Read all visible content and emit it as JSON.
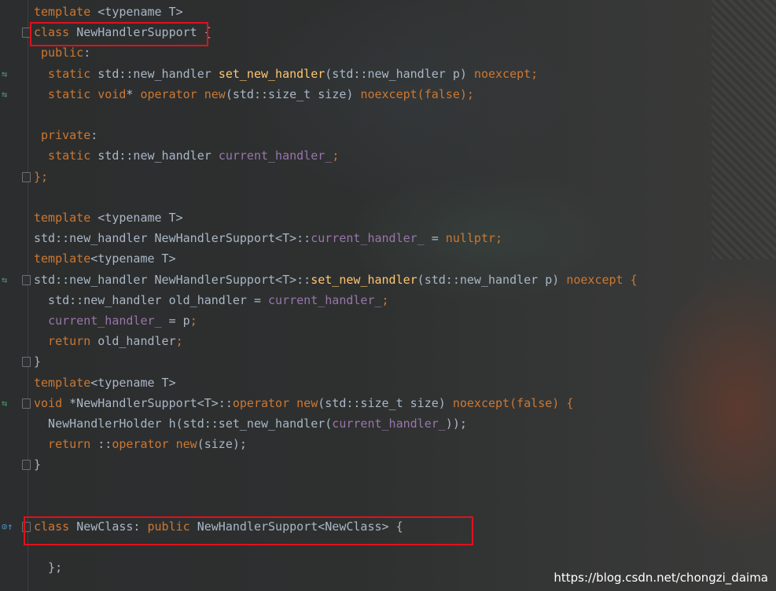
{
  "code_lines": [
    {
      "icon": "",
      "fold": false,
      "tokens": [
        {
          "t": "template ",
          "c": "kw"
        },
        {
          "t": "<typename T>",
          "c": "tk"
        }
      ]
    },
    {
      "icon": "",
      "fold": true,
      "tokens": [
        {
          "t": "class ",
          "c": "kw"
        },
        {
          "t": "NewHandlerSupport ",
          "c": "tk"
        },
        {
          "t": "{",
          "c": "tk"
        }
      ]
    },
    {
      "icon": "",
      "fold": false,
      "tokens": [
        {
          "t": " public",
          "c": "kw"
        },
        {
          "t": ":",
          "c": "tk"
        }
      ]
    },
    {
      "icon": "⇆",
      "fold": false,
      "tokens": [
        {
          "t": "  static ",
          "c": "kw"
        },
        {
          "t": "std::new_handler ",
          "c": "tk"
        },
        {
          "t": "set_new_handler",
          "c": "fn"
        },
        {
          "t": "(std::new_handler p) ",
          "c": "tk"
        },
        {
          "t": "noexcept;",
          "c": "kw"
        }
      ]
    },
    {
      "icon": "⇆",
      "fold": false,
      "tokens": [
        {
          "t": "  static void",
          "c": "kw"
        },
        {
          "t": "* ",
          "c": "tk"
        },
        {
          "t": "operator new",
          "c": "kw"
        },
        {
          "t": "(std::size_t size) ",
          "c": "tk"
        },
        {
          "t": "noexcept(false);",
          "c": "kw"
        }
      ]
    },
    {
      "icon": "",
      "fold": false,
      "tokens": []
    },
    {
      "icon": "",
      "fold": false,
      "tokens": [
        {
          "t": " private",
          "c": "kw"
        },
        {
          "t": ":",
          "c": "tk"
        }
      ]
    },
    {
      "icon": "",
      "fold": false,
      "tokens": [
        {
          "t": "  static ",
          "c": "kw"
        },
        {
          "t": "std::new_handler ",
          "c": "tk"
        },
        {
          "t": "current_handler_",
          "c": "fld"
        },
        {
          "t": ";",
          "c": "kw"
        }
      ]
    },
    {
      "icon": "",
      "fold": true,
      "tokens": [
        {
          "t": "};",
          "c": "kw"
        }
      ]
    },
    {
      "icon": "",
      "fold": false,
      "tokens": []
    },
    {
      "icon": "",
      "fold": false,
      "tokens": [
        {
          "t": "template ",
          "c": "kw"
        },
        {
          "t": "<typename T>",
          "c": "tk"
        }
      ]
    },
    {
      "icon": "",
      "fold": false,
      "tokens": [
        {
          "t": "std::new_handler NewHandlerSupport<T>::",
          "c": "tk"
        },
        {
          "t": "current_handler_",
          "c": "fld"
        },
        {
          "t": " = ",
          "c": "tk"
        },
        {
          "t": "nullptr;",
          "c": "kw"
        }
      ]
    },
    {
      "icon": "",
      "fold": false,
      "tokens": [
        {
          "t": "template",
          "c": "kw"
        },
        {
          "t": "<typename T>",
          "c": "tk"
        }
      ]
    },
    {
      "icon": "⇆",
      "fold": true,
      "tokens": [
        {
          "t": "std::new_handler NewHandlerSupport<T>::",
          "c": "tk"
        },
        {
          "t": "set_new_handler",
          "c": "fn"
        },
        {
          "t": "(std::new_handler p) ",
          "c": "tk"
        },
        {
          "t": "noexcept {",
          "c": "kw"
        }
      ]
    },
    {
      "icon": "",
      "fold": false,
      "tokens": [
        {
          "t": "  std::new_handler old_handler = ",
          "c": "tk"
        },
        {
          "t": "current_handler_",
          "c": "fld"
        },
        {
          "t": ";",
          "c": "kw"
        }
      ]
    },
    {
      "icon": "",
      "fold": false,
      "tokens": [
        {
          "t": "  ",
          "c": "tk"
        },
        {
          "t": "current_handler_",
          "c": "fld"
        },
        {
          "t": " = p",
          "c": "tk"
        },
        {
          "t": ";",
          "c": "kw"
        }
      ]
    },
    {
      "icon": "",
      "fold": false,
      "tokens": [
        {
          "t": "  return ",
          "c": "kw"
        },
        {
          "t": "old_handler",
          "c": "tk"
        },
        {
          "t": ";",
          "c": "kw"
        }
      ]
    },
    {
      "icon": "",
      "fold": true,
      "tokens": [
        {
          "t": "}",
          "c": "tk"
        }
      ]
    },
    {
      "icon": "",
      "fold": false,
      "tokens": [
        {
          "t": "template",
          "c": "kw"
        },
        {
          "t": "<typename T>",
          "c": "tk"
        }
      ]
    },
    {
      "icon": "⇆",
      "fold": true,
      "tokens": [
        {
          "t": "void ",
          "c": "kw"
        },
        {
          "t": "*NewHandlerSupport<T>::",
          "c": "tk"
        },
        {
          "t": "operator new",
          "c": "kw"
        },
        {
          "t": "(std::size_t size) ",
          "c": "tk"
        },
        {
          "t": "noexcept(false) {",
          "c": "kw"
        }
      ]
    },
    {
      "icon": "",
      "fold": false,
      "tokens": [
        {
          "t": "  NewHandlerHolder h(std::set_new_handler(",
          "c": "tk"
        },
        {
          "t": "current_handler_",
          "c": "fld"
        },
        {
          "t": "));",
          "c": "tk"
        }
      ]
    },
    {
      "icon": "",
      "fold": false,
      "tokens": [
        {
          "t": "  return ",
          "c": "kw"
        },
        {
          "t": "::",
          "c": "tk"
        },
        {
          "t": "operator new",
          "c": "kw"
        },
        {
          "t": "(size);",
          "c": "tk"
        }
      ]
    },
    {
      "icon": "",
      "fold": true,
      "tokens": [
        {
          "t": "}",
          "c": "tk"
        }
      ]
    },
    {
      "icon": "",
      "fold": false,
      "tokens": []
    },
    {
      "icon": "",
      "fold": false,
      "tokens": []
    },
    {
      "icon": "⊙↑",
      "fold": true,
      "tokens": [
        {
          "t": "class ",
          "c": "kw"
        },
        {
          "t": "NewClass: ",
          "c": "tk"
        },
        {
          "t": "public ",
          "c": "kw"
        },
        {
          "t": "NewHandlerSupport<NewClass> {",
          "c": "tk"
        }
      ]
    },
    {
      "icon": "",
      "fold": false,
      "tokens": []
    },
    {
      "icon": "",
      "fold": false,
      "tokens": [
        {
          "t": "  };",
          "c": "tk"
        }
      ]
    }
  ],
  "watermark": "https://blog.csdn.net/chongzi_daima",
  "colors": {
    "keyword": "#cc7832",
    "function": "#ffc66d",
    "field": "#9876aa",
    "text": "#a9b7c6",
    "highlight_box": "#e0111b"
  }
}
